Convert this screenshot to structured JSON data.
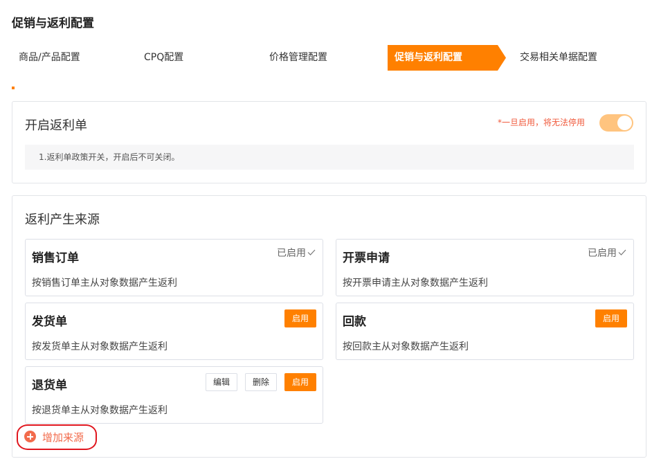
{
  "page": {
    "title": "促销与返利配置"
  },
  "steps": [
    {
      "label": "商品/产品配置",
      "active": false
    },
    {
      "label": "CPQ配置",
      "active": false
    },
    {
      "label": "价格管理配置",
      "active": false
    },
    {
      "label": "促销与返利配置",
      "active": true
    },
    {
      "label": "交易相关单据配置",
      "active": false
    }
  ],
  "rebate_switch": {
    "title": "开启返利单",
    "warning": "*一旦启用，将无法停用",
    "enabled": true,
    "note": "1.返利单政策开关，开启后不可关闭。"
  },
  "sources": {
    "title": "返利产生来源",
    "enabled_label": "已启用",
    "cards": [
      {
        "title": "销售订单",
        "desc": "按销售订单主从对象数据产生返利",
        "status": "已启用"
      },
      {
        "title": "开票申请",
        "desc": "按开票申请主从对象数据产生返利",
        "status": "已启用"
      },
      {
        "title": "发货单",
        "desc": "按发货单主从对象数据产生返利",
        "enable_label": "启用"
      },
      {
        "title": "回款",
        "desc": "按回款主从对象数据产生返利",
        "enable_label": "启用"
      },
      {
        "title": "退货单",
        "desc": "按退货单主从对象数据产生返利",
        "edit_label": "编辑",
        "delete_label": "删除",
        "enable_label": "启用"
      }
    ],
    "add_label": "增加来源"
  },
  "colors": {
    "accent": "#ff8000",
    "warning": "#f05a3c",
    "add": "#f26b4c",
    "highlight": "#e0161e",
    "toggle_on": "#ffc47f"
  }
}
